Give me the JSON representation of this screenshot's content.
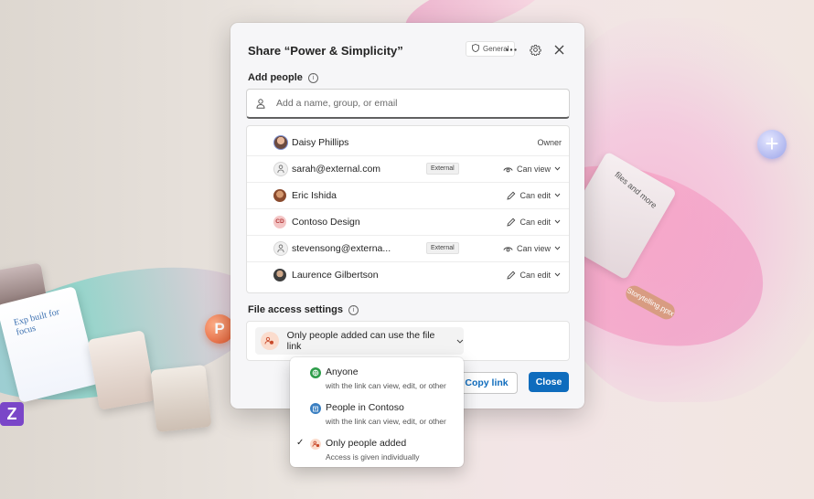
{
  "background": {
    "card_text": "Exp built for focus",
    "note_text": "files and more",
    "tag_text": "Storytelling.pptx",
    "ppt_letter": "P",
    "app_letter": "Z"
  },
  "dialog": {
    "title": "Share “Power & Simplicity”",
    "sensitivity_label": "General",
    "more_icon": "more-horizontal-icon",
    "settings_icon": "gear-icon",
    "close_icon": "close-icon"
  },
  "add_people": {
    "label": "Add people",
    "placeholder": "Add a name, group, or email"
  },
  "people": [
    {
      "name": "Daisy Phillips",
      "avatar": "photo",
      "avatar_color": "#6b4a3f",
      "permission": "Owner",
      "external": false,
      "perm_icon": "none"
    },
    {
      "name": "sarah@external.com",
      "avatar": "person-icon",
      "avatar_color": "#f0f0f0",
      "badge": "External",
      "permission": "Can view",
      "external": true,
      "perm_icon": "eye-icon"
    },
    {
      "name": "Eric Ishida",
      "avatar": "photo",
      "avatar_color": "#8a4b2e",
      "permission": "Can edit",
      "external": false,
      "perm_icon": "pencil-icon"
    },
    {
      "name": "Contoso Design",
      "avatar": "CD",
      "avatar_color": "#f4c6c6",
      "permission": "Can edit",
      "external": false,
      "perm_icon": "pencil-icon"
    },
    {
      "name": "stevensong@externa...",
      "avatar": "person-icon",
      "avatar_color": "#f0f0f0",
      "badge": "External",
      "permission": "Can view",
      "external": true,
      "perm_icon": "eye-icon"
    },
    {
      "name": "Laurence Gilbertson",
      "avatar": "photo",
      "avatar_color": "#3d3d3d",
      "permission": "Can edit",
      "external": false,
      "perm_icon": "pencil-icon"
    }
  ],
  "file_access": {
    "label": "File access settings",
    "current": "Only people added can use the file link"
  },
  "footer": {
    "copy_link": "Copy link",
    "close": "Close"
  },
  "dropdown": {
    "options": [
      {
        "title": "Anyone",
        "subtitle": "with the link can view, edit, or other",
        "icon": "globe-icon",
        "color": "#2e9d4a",
        "selected": false
      },
      {
        "title": "People in Contoso",
        "subtitle": "with the link can view, edit, or other",
        "icon": "building-icon",
        "color": "#3a7fc1",
        "selected": false
      },
      {
        "title": "Only people added",
        "subtitle": "Access is given individually",
        "icon": "people-restricted-icon",
        "color": "#d2582f",
        "selected": true
      }
    ],
    "check_glyph": "✓"
  },
  "colors": {
    "accent": "#0f6cbd",
    "dialog_bg": "#f6f6f8"
  }
}
